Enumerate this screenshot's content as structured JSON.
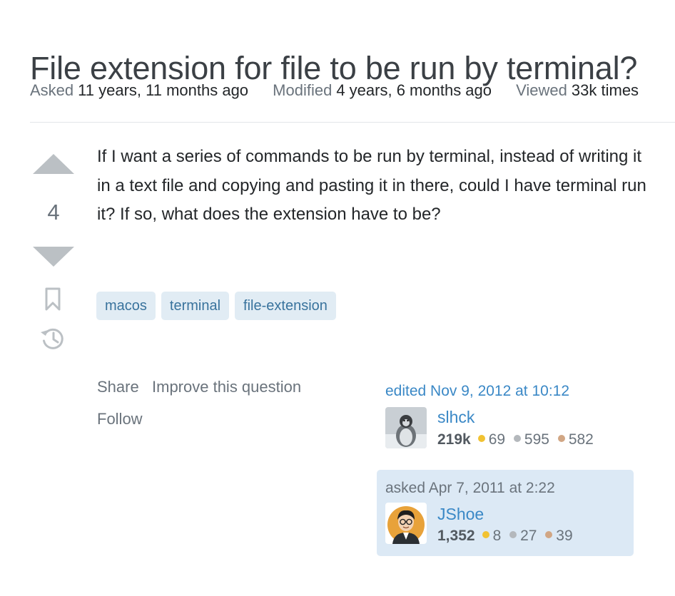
{
  "question": {
    "title": "File extension for file to be run by terminal?",
    "meta": {
      "asked_label": "Asked",
      "asked_value": "11 years, 11 months ago",
      "modified_label": "Modified",
      "modified_value": "4 years, 6 months ago",
      "viewed_label": "Viewed",
      "viewed_value": "33k times"
    },
    "vote_count": "4",
    "body": "If I want a series of commands to be run by terminal, instead of writing it in a text file and copying and pasting it in there, could I have terminal run it? If so, what does the extension have to be?",
    "tags": [
      "macos",
      "terminal",
      "file-extension"
    ]
  },
  "post_menu": {
    "share": "Share",
    "improve": "Improve this question",
    "follow": "Follow"
  },
  "editor": {
    "action": "edited Nov 9, 2012 at 10:12",
    "name": "slhck",
    "reputation": "219k",
    "gold": "69",
    "silver": "595",
    "bronze": "582"
  },
  "owner": {
    "action": "asked Apr 7, 2011 at 2:22",
    "name": "JShoe",
    "reputation": "1,352",
    "gold": "8",
    "silver": "27",
    "bronze": "39"
  },
  "colors": {
    "link": "#3a88c6",
    "tag_bg": "#e1ecf4",
    "tag_text": "#39739d",
    "owner_card_bg": "#dce9f5",
    "gold": "#f1c232",
    "silver": "#b4b8bc",
    "bronze": "#d1a684",
    "vote_arrow": "#bbc0c4"
  },
  "icons": {
    "vote_up": "caret-up-icon",
    "vote_down": "caret-down-icon",
    "bookmark": "bookmark-icon",
    "history": "history-icon"
  }
}
